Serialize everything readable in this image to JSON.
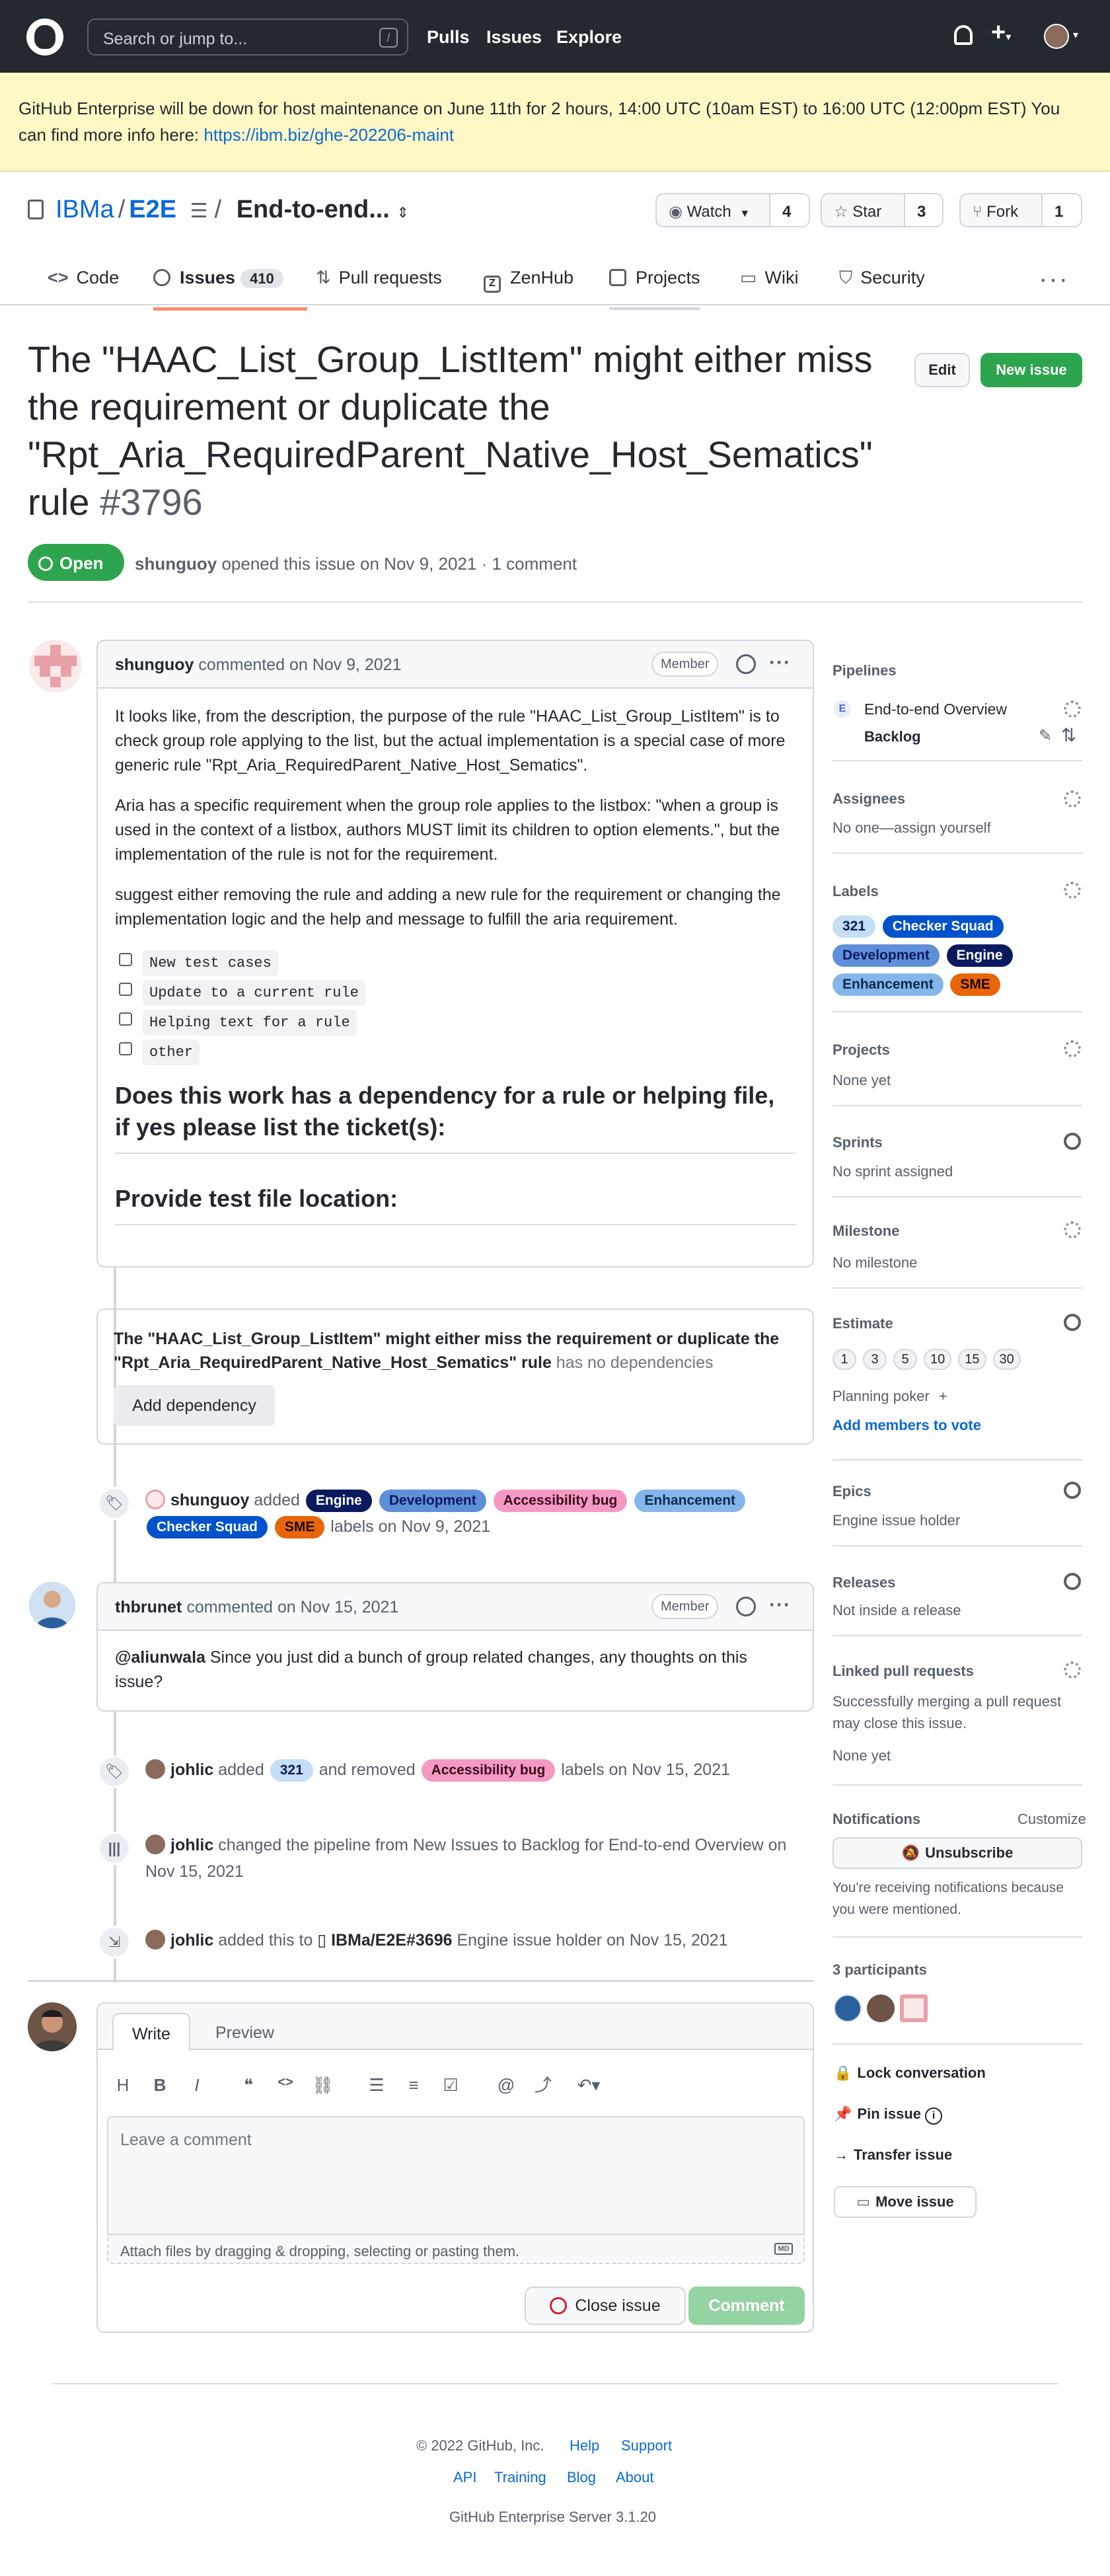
{
  "topbar": {
    "search_placeholder": "Search or jump to...",
    "search_key": "/",
    "nav": [
      "Pulls",
      "Issues",
      "Explore"
    ],
    "plus": "+",
    "caret": "▾"
  },
  "banner": {
    "text": "GitHub Enterprise will be down for host maintenance on June 11th for 2 hours, 14:00 UTC (10am EST) to 16:00 UTC (12:00pm EST) You can find more info here: ",
    "link": "https://ibm.biz/ghe-202206-maint"
  },
  "repo": {
    "owner": "IBMa",
    "name": "E2E",
    "project": "End-to-end...",
    "watch_label": "Watch",
    "watch_count": "4",
    "star_label": "Star",
    "star_count": "3",
    "fork_label": "Fork",
    "fork_count": "1"
  },
  "tabs": [
    {
      "label": "Code"
    },
    {
      "label": "Issues",
      "count": "410"
    },
    {
      "label": "Pull requests"
    },
    {
      "label": "ZenHub"
    },
    {
      "label": "Projects"
    },
    {
      "label": "Wiki"
    },
    {
      "label": "Security"
    }
  ],
  "issue": {
    "title": "The \"HAAC_List_Group_ListItem\" might either miss the requirement or duplicate the \"Rpt_Aria_RequiredParent_Native_Host_Sematics\" rule",
    "number": "#3796",
    "edit_label": "Edit",
    "new_issue_label": "New issue",
    "state": "Open",
    "author": "shunguoy",
    "meta": " opened this issue on Nov 9, 2021 · 1 comment"
  },
  "comment1": {
    "author": "shunguoy",
    "action": " commented on Nov 9, 2021",
    "role": "Member",
    "p1": "It looks like, from the description, the purpose of the rule \"HAAC_List_Group_ListItem\" is to check group role applying to the list, but the actual implementation is a special case of more generic rule \"Rpt_Aria_RequiredParent_Native_Host_Sematics\".",
    "p2": "Aria has a specific requirement when the group role applies to the listbox: \"when a group is used in the context of a listbox, authors MUST limit its children to option elements.\", but the implementation of the rule is not for the requirement.",
    "p3": "suggest either removing the rule and adding a new rule for the requirement or changing the implementation logic and the help and message to fulfill the aria requirement.",
    "tasks": [
      "New test cases",
      "Update to a current rule",
      "Helping text for a rule",
      "other"
    ],
    "h1": "Does this work has a dependency for a rule or helping file, if yes please list the ticket(s):",
    "h2": "Provide test file location:"
  },
  "dependency": {
    "text": "The \"HAAC_List_Group_ListItem\" might either miss the requirement or duplicate the \"Rpt_Aria_RequiredParent_Native_Host_Sematics\" rule",
    "suffix": " has no dependencies",
    "button": "Add dependency"
  },
  "event_labels": {
    "actor": "shunguoy",
    "verb": " added ",
    "labels": [
      "Engine",
      "Development",
      "Accessibility bug",
      "Enhancement",
      "Checker Squad",
      "SME"
    ],
    "suffix": " labels on Nov 9, 2021"
  },
  "comment2": {
    "author": "thbrunet",
    "action": " commented on Nov 15, 2021",
    "role": "Member",
    "mention": "@aliunwala",
    "body": " Since you just did a bunch of group related changes, any thoughts on this issue?"
  },
  "event_relabel": {
    "actor": "johlic",
    "added": " added ",
    "label_added": "321",
    "removed": " and removed ",
    "label_removed": "Accessibility bug",
    "suffix": " labels on Nov 15, 2021"
  },
  "event_pipeline": {
    "actor": "johlic",
    "text": " changed the pipeline from New Issues to Backlog for End-to-end Overview on Nov 15, 2021"
  },
  "event_epic": {
    "actor": "johlic",
    "text": " added this to ",
    "ref": "IBMa/E2E#3696",
    "suffix": " Engine issue holder on Nov 15, 2021"
  },
  "write": {
    "tab_write": "Write",
    "tab_preview": "Preview",
    "placeholder": "Leave a comment",
    "attach": "Attach files by dragging & dropping, selecting or pasting them.",
    "md_badge": "MD",
    "close_label": "Close issue",
    "submit_label": "Comment"
  },
  "sidebar": {
    "pipelines_title": "Pipelines",
    "pipeline_badge": "E",
    "pipeline_board": "End-to-end Overview",
    "pipeline_stage": "Backlog",
    "assignees_title": "Assignees",
    "assignees_text": "No one—assign yourself",
    "labels_title": "Labels",
    "labels": [
      "321",
      "Checker Squad",
      "Development",
      "Engine",
      "Enhancement",
      "SME"
    ],
    "projects_title": "Projects",
    "projects_text": "None yet",
    "sprints_title": "Sprints",
    "sprints_text": "No sprint assigned",
    "milestone_title": "Milestone",
    "milestone_text": "No milestone",
    "estimate_title": "Estimate",
    "estimates": [
      "1",
      "3",
      "5",
      "10",
      "15",
      "30"
    ],
    "poker": "Planning poker",
    "poker_plus": "+",
    "vote_link": "Add members to vote",
    "epics_title": "Epics",
    "epics_text": "Engine issue holder",
    "releases_title": "Releases",
    "releases_text": "Not inside a release",
    "linked_title": "Linked pull requests",
    "linked_text": "Successfully merging a pull request may close this issue.",
    "linked_none": "None yet",
    "notif_title": "Notifications",
    "notif_customize": "Customize",
    "unsubscribe": "Unsubscribe",
    "notif_reason": "You're receiving notifications because you were mentioned.",
    "participants_title": "3 participants",
    "lock": "Lock conversation",
    "pin": "Pin issue",
    "transfer": "Transfer issue",
    "move": "Move issue"
  },
  "footer": {
    "copyright": "© 2022 GitHub, Inc.",
    "help": "Help",
    "support": "Support",
    "api": "API",
    "training": "Training",
    "blog": "Blog",
    "about": "About",
    "version": "GitHub Enterprise Server 3.1.20"
  },
  "colors": {
    "label_321": "#c5def5",
    "label_checker_squad": "#0052cc",
    "label_development": "#5f8fd8",
    "label_engine": "#0b1a5e",
    "label_enhancement": "#84b6eb",
    "label_sme": "#e8650a",
    "label_accessibility_bug": "#f49ac2",
    "open_green": "#2da44e"
  }
}
